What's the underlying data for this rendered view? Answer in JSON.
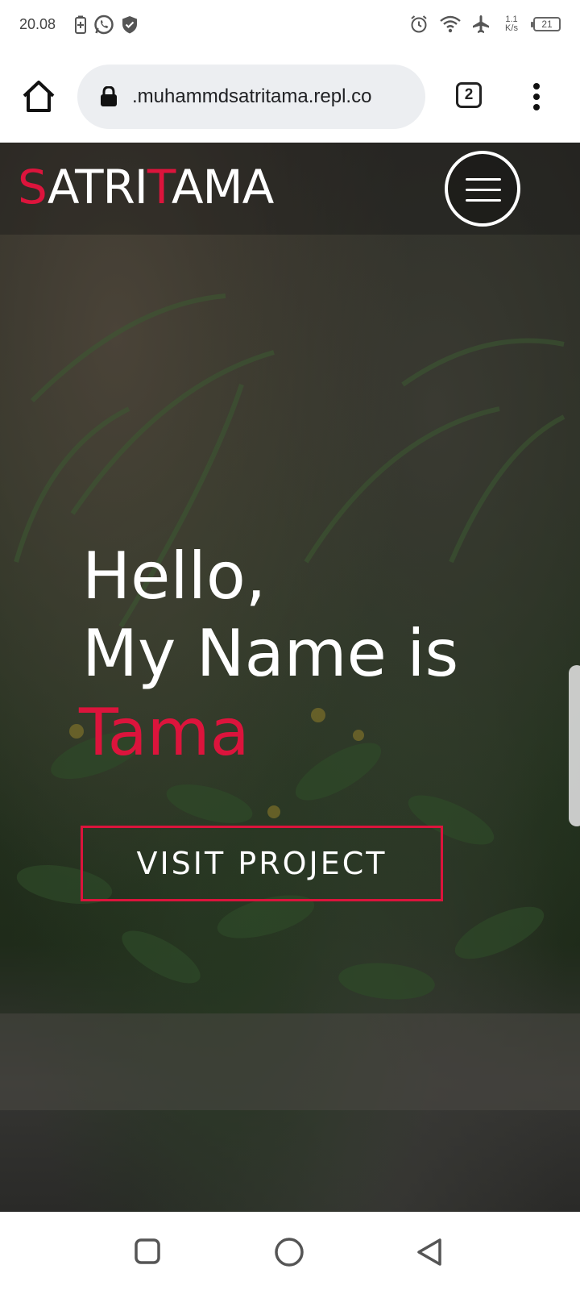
{
  "status_bar": {
    "time": "20.08",
    "net_speed_value": "1.1",
    "net_speed_unit": "K/s",
    "battery": "21",
    "left_icons": [
      "battery-saver-icon",
      "whatsapp-icon",
      "shield-icon"
    ],
    "right_icons": [
      "alarm-icon",
      "wifi-icon",
      "airplane-icon"
    ]
  },
  "browser": {
    "url": ".muhammdsatritama.repl.co",
    "tab_count": "2"
  },
  "site": {
    "logo_parts": [
      "S",
      "ATRI",
      "T",
      "AMA"
    ],
    "accent_color": "#dc143c",
    "hero_line_1": "Hello,",
    "hero_line_2": "My Name is",
    "hero_name": "Tama",
    "cta_label": "VISIT PROJECT"
  },
  "nav_bar": {
    "buttons": [
      "recents-square-icon",
      "home-circle-icon",
      "back-triangle-icon"
    ]
  }
}
